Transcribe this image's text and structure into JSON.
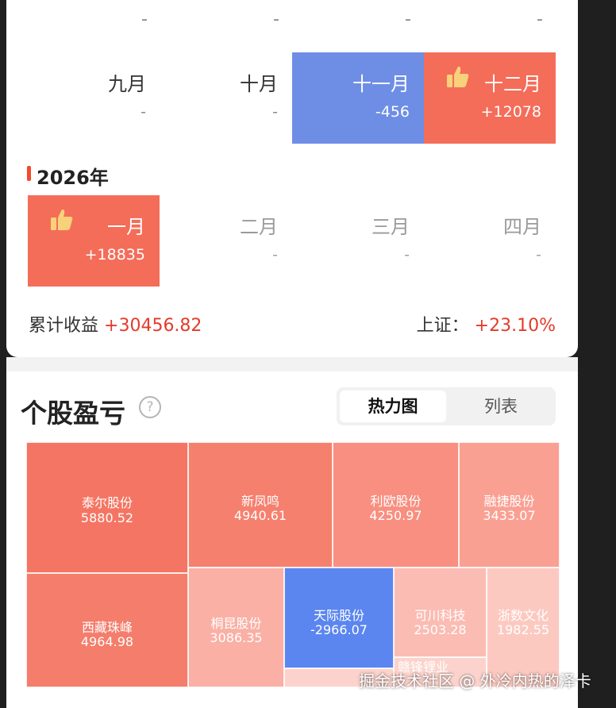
{
  "placeholder_row": [
    "-",
    "-",
    "-",
    "-"
  ],
  "months_2025_q4": [
    {
      "label": "九月",
      "value": "-",
      "style": "plain"
    },
    {
      "label": "十月",
      "value": "-",
      "style": "plain"
    },
    {
      "label": "十一月",
      "value": "-456",
      "style": "loss"
    },
    {
      "label": "十二月",
      "value": "+12078",
      "style": "gain",
      "icon": "thumbs-up-icon"
    }
  ],
  "year_2026": {
    "title": "2026年",
    "months": [
      {
        "label": "一月",
        "value": "+18835",
        "style": "gain",
        "icon": "thumbs-up-icon"
      },
      {
        "label": "二月",
        "value": "-",
        "style": "muted"
      },
      {
        "label": "三月",
        "value": "-",
        "style": "muted"
      },
      {
        "label": "四月",
        "value": "-",
        "style": "muted"
      }
    ]
  },
  "summary": {
    "cumulative_label": "累计收益",
    "cumulative_value": "+30456.82",
    "index_label": "上证：",
    "index_value": "+23.10%"
  },
  "stock_pnl": {
    "title": "个股盈亏",
    "help_icon": "question-circle-icon",
    "tabs": [
      {
        "label": "热力图",
        "active": true
      },
      {
        "label": "列表",
        "active": false
      }
    ],
    "heatmap": [
      {
        "name": "泰尔股份",
        "value": "5880.52",
        "color": "#f47563"
      },
      {
        "name": "新凤鸣",
        "value": "4940.61",
        "color": "#f6806e"
      },
      {
        "name": "利欧股份",
        "value": "4250.97",
        "color": "#f88f80"
      },
      {
        "name": "融捷股份",
        "value": "3433.07",
        "color": "#faa093"
      },
      {
        "name": "西藏珠峰",
        "value": "4964.98",
        "color": "#f47d6b"
      },
      {
        "name": "桐昆股份",
        "value": "3086.35",
        "color": "#fab0a5"
      },
      {
        "name": "天际股份",
        "value": "-2966.07",
        "color": "#5b86f0"
      },
      {
        "name": "可川科技",
        "value": "2503.28",
        "color": "#fbbcb3"
      },
      {
        "name": "浙数文化",
        "value": "1982.55",
        "color": "#fcc9c1"
      },
      {
        "name": "赣锋锂业",
        "value": "",
        "color": "#fcd3cc"
      }
    ]
  },
  "watermark": "掘金技术社区 @ 外冷内热的泽卡",
  "colors": {
    "gain": "#f46d59",
    "loss": "#6e8ee6",
    "accent": "#e33b2c"
  }
}
